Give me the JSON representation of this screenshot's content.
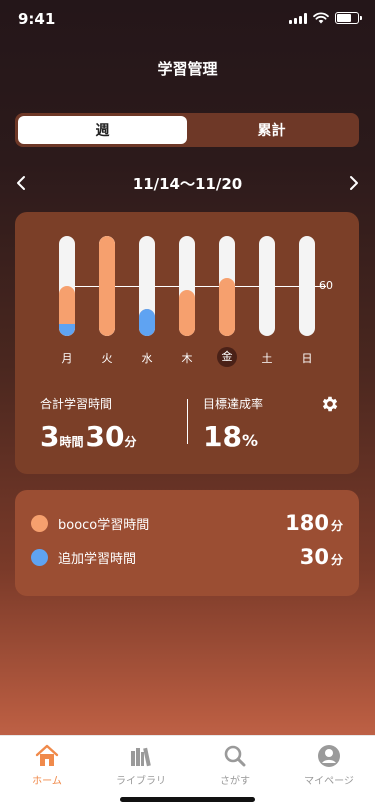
{
  "status": {
    "time": "9:41"
  },
  "header": {
    "title": "学習管理"
  },
  "segment": {
    "week_label": "週",
    "total_label": "累計",
    "selected": "週"
  },
  "week_nav": {
    "range": "11/14〜11/20"
  },
  "chart_data": {
    "type": "bar",
    "categories": [
      "月",
      "火",
      "水",
      "木",
      "金",
      "土",
      "日"
    ],
    "series": [
      {
        "name": "booco学習時間",
        "values": [
          45,
          120,
          0,
          55,
          70,
          0,
          0
        ]
      },
      {
        "name": "追加学習時間",
        "values": [
          15,
          0,
          33,
          0,
          0,
          0,
          0
        ]
      }
    ],
    "goal_line": 60,
    "goal_label": "60",
    "ylim": [
      0,
      120
    ],
    "highlighted_day": "金",
    "colors": {
      "booco": "#f6a06e",
      "additional": "#5fa3f2",
      "track": "#f4f4f4"
    }
  },
  "stats": {
    "total_label": "合計学習時間",
    "total_hours": "3",
    "hours_unit": "時間",
    "total_minutes": "30",
    "minutes_unit": "分",
    "rate_label": "目標達成率",
    "rate_value": "18",
    "rate_unit": "%"
  },
  "legend": [
    {
      "label": "booco学習時間",
      "value": "180",
      "unit": "分",
      "color": "#f6a06e"
    },
    {
      "label": "追加学習時間",
      "value": "30",
      "unit": "分",
      "color": "#5fa3f2"
    }
  ],
  "tabbar": [
    {
      "label": "ホーム",
      "icon": "home-icon",
      "active": true
    },
    {
      "label": "ライブラリ",
      "icon": "library-icon",
      "active": false
    },
    {
      "label": "さがす",
      "icon": "search-icon",
      "active": false
    },
    {
      "label": "マイページ",
      "icon": "profile-icon",
      "active": false
    }
  ]
}
